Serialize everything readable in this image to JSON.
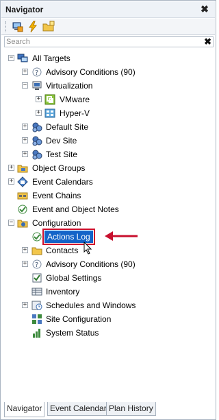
{
  "panel": {
    "title": "Navigator",
    "close_glyph": "✖"
  },
  "toolbar": {
    "buttons": [
      {
        "name": "add-target-button",
        "icon": "computer-add-icon"
      },
      {
        "name": "lightning-button",
        "icon": "lightning-icon"
      },
      {
        "name": "folder-add-button",
        "icon": "folder-add-icon"
      }
    ]
  },
  "search": {
    "placeholder": "Search",
    "value": "",
    "clear_glyph": "✖"
  },
  "tree": {
    "all_targets": "All Targets",
    "advisory_conditions_1": "Advisory Conditions (90)",
    "virtualization": "Virtualization",
    "vmware": "VMware",
    "hyperv": "Hyper-V",
    "default_site": "Default Site",
    "dev_site": "Dev Site",
    "test_site": "Test Site",
    "object_groups": "Object Groups",
    "event_calendars": "Event Calendars",
    "event_chains": "Event Chains",
    "event_object_notes": "Event and Object Notes",
    "configuration": "Configuration",
    "actions_log": "Actions Log",
    "contacts": "Contacts",
    "advisory_conditions_2": "Advisory Conditions (90)",
    "global_settings": "Global Settings",
    "inventory": "Inventory",
    "schedules_windows": "Schedules and Windows",
    "site_configuration": "Site Configuration",
    "system_status": "System Status"
  },
  "tabs": [
    "Navigator",
    "Event Calendar",
    "Plan History"
  ],
  "colors": {
    "selection": "#1464c8",
    "highlight_border": "#d0102c",
    "arrow": "#c8102e"
  }
}
